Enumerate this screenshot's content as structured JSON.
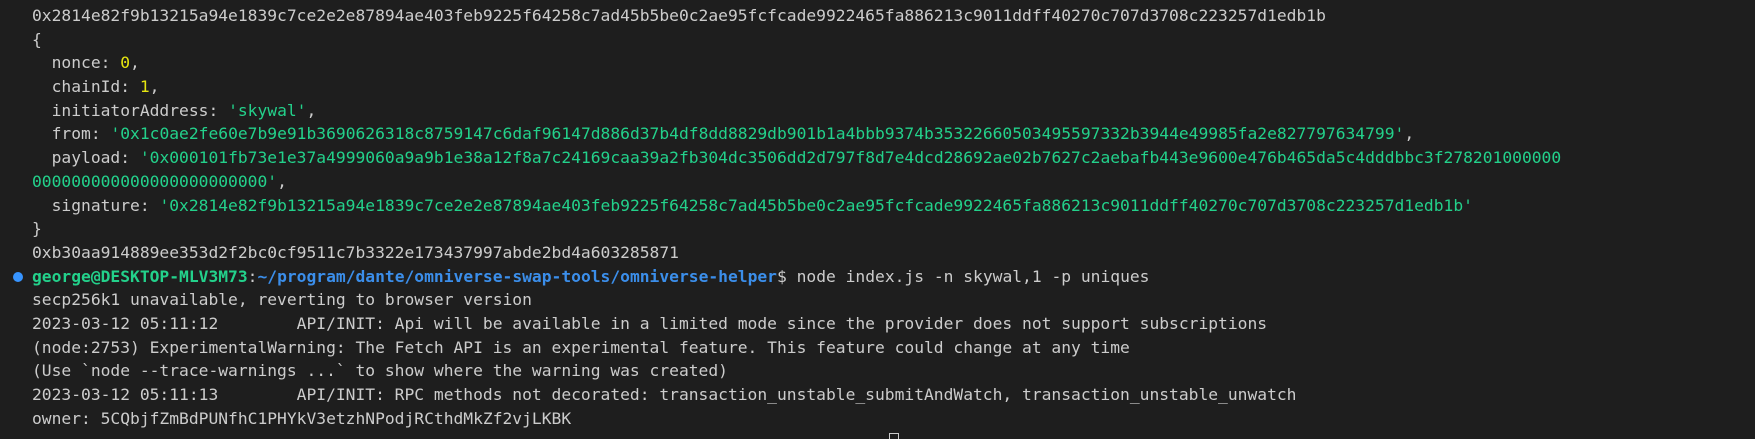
{
  "terminal": {
    "signature_hash": "0x2814e82f9b13215a94e1839c7ce2e2e87894ae403feb9225f64258c7ad45b5be0c2ae95fcfcade9922465fa886213c9011ddff40270c707d3708c223257d1edb1b",
    "object": {
      "open_brace": "{",
      "close_brace": "}",
      "nonce_key": "nonce: ",
      "nonce_val": "0",
      "chainid_key": "chainId: ",
      "chainid_val": "1",
      "initiator_key": "initiatorAddress: ",
      "initiator_val": "'skywal'",
      "from_key": "from: ",
      "from_val": "'0x1c0ae2fe60e7b9e91b3690626318c8759147c6daf96147d886d37b4df8dd8829db901b1a4bbb9374b35322660503495597332b3944e49985fa2e827797634799'",
      "payload_key": "payload: ",
      "payload_val_1": "'0x000101fb73e1e37a4999060a9a9b1e38a12f8a7c24169caa39a2fb304dc3506dd2d797f8d7e4dcd28692ae02b7627c2aebafb443e9600e476b465da5c4dddbbc3f278201000000",
      "payload_val_2": "000000000000000000000000'",
      "signature_key": "signature: ",
      "signature_val": "'0x2814e82f9b13215a94e1839c7ce2e2e87894ae403feb9225f64258c7ad45b5be0c2ae95fcfcade9922465fa886213c9011ddff40270c707d3708c223257d1edb1b'",
      "comma": ","
    },
    "tx_hash": "0xb30aa914889ee353d2f2bc0cf9511c7b3322e173437997abde2bd4a603285871",
    "prompt": {
      "user_host": "george@DESKTOP-MLV3M73",
      "colon": ":",
      "path": "~/program/dante/omniverse-swap-tools/omniverse-helper",
      "symbol": "$ ",
      "command": "node index.js -n skywal,1 -p uniques"
    },
    "output": [
      "secp256k1 unavailable, reverting to browser version",
      "2023-03-12 05:11:12        API/INIT: Api will be available in a limited mode since the provider does not support subscriptions",
      "(node:2753) ExperimentalWarning: The Fetch API is an experimental feature. This feature could change at any time",
      "(Use `node --trace-warnings ...` to show where the warning was created)",
      "2023-03-12 05:11:13        API/INIT: RPC methods not decorated: transaction_unstable_submitAndWatch, transaction_unstable_unwatch",
      "owner: 5CQbjfZmBdPUNfhC1PHYkV3etzhNPodjRCthdMkZf2vjLKBK"
    ],
    "colors": {
      "background": "#1e1e1e",
      "foreground": "#cccccc",
      "number": "#e5e510",
      "string": "#23d18b",
      "prompt_path": "#3b8eea",
      "decoration_dot": "#3794ff"
    }
  }
}
